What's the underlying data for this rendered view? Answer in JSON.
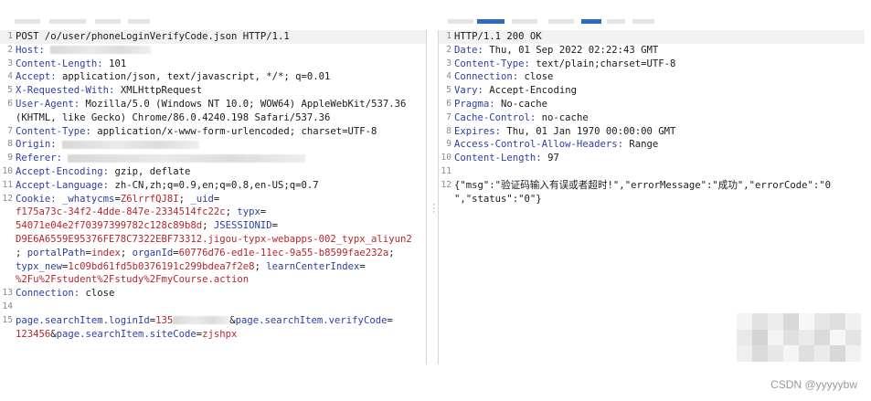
{
  "request": {
    "lines": [
      {
        "n": "1",
        "parts": [
          {
            "t": "POST /o/user/phoneLoginVerifyCode.json HTTP/1.1",
            "c": "hval"
          }
        ]
      },
      {
        "n": "2",
        "parts": [
          {
            "t": "Host: ",
            "c": "hname"
          }
        ],
        "redact": 110
      },
      {
        "n": "3",
        "parts": [
          {
            "t": "Content-Length: ",
            "c": "hname"
          },
          {
            "t": "101",
            "c": "hval"
          }
        ]
      },
      {
        "n": "4",
        "parts": [
          {
            "t": "Accept: ",
            "c": "hname"
          },
          {
            "t": "application/json, text/javascript, */*; q=0.01",
            "c": "hval"
          }
        ]
      },
      {
        "n": "5",
        "parts": [
          {
            "t": "X-Requested-With: ",
            "c": "hname"
          },
          {
            "t": "XMLHttpRequest",
            "c": "hval"
          }
        ]
      },
      {
        "n": "6",
        "parts": [
          {
            "t": "User-Agent: ",
            "c": "hname"
          },
          {
            "t": "Mozilla/5.0 (Windows NT 10.0; WOW64) AppleWebKit/537.36",
            "c": "hval"
          }
        ]
      },
      {
        "n": "",
        "parts": [
          {
            "t": "(KHTML, like Gecko) Chrome/86.0.4240.198 Safari/537.36",
            "c": "hval"
          }
        ]
      },
      {
        "n": "7",
        "parts": [
          {
            "t": "Content-Type: ",
            "c": "hname"
          },
          {
            "t": "application/x-www-form-urlencoded; charset=UTF-8",
            "c": "hval"
          }
        ]
      },
      {
        "n": "8",
        "parts": [
          {
            "t": "Origin: ",
            "c": "hname"
          }
        ],
        "redact": 150
      },
      {
        "n": "9",
        "parts": [
          {
            "t": "Referer: ",
            "c": "hname"
          }
        ],
        "redact": 260
      },
      {
        "n": "10",
        "parts": [
          {
            "t": "Accept-Encoding: ",
            "c": "hname"
          },
          {
            "t": "gzip, deflate",
            "c": "hval"
          }
        ]
      },
      {
        "n": "11",
        "parts": [
          {
            "t": "Accept-Language: ",
            "c": "hname"
          },
          {
            "t": "zh-CN,zh;q=0.9,en;q=0.8,en-US;q=0.7",
            "c": "hval"
          }
        ]
      },
      {
        "n": "12",
        "parts": [
          {
            "t": "Cookie: ",
            "c": "hname"
          },
          {
            "t": "_whatycms",
            "c": "blue"
          },
          {
            "t": "=",
            "c": "hval"
          },
          {
            "t": "Z6lrrfQJ8I",
            "c": "red"
          },
          {
            "t": "; ",
            "c": "hval"
          },
          {
            "t": "_uid",
            "c": "blue"
          },
          {
            "t": "=",
            "c": "hval"
          }
        ]
      },
      {
        "n": "",
        "parts": [
          {
            "t": "f175a73c-34f2-4dde-847e-2334514fc22c",
            "c": "red"
          },
          {
            "t": "; ",
            "c": "hval"
          },
          {
            "t": "typx",
            "c": "blue"
          },
          {
            "t": "=",
            "c": "hval"
          }
        ]
      },
      {
        "n": "",
        "parts": [
          {
            "t": "54071e04e2f70397399782c128c89b8d",
            "c": "red"
          },
          {
            "t": "; ",
            "c": "hval"
          },
          {
            "t": "JSESSIONID",
            "c": "blue"
          },
          {
            "t": "=",
            "c": "hval"
          }
        ]
      },
      {
        "n": "",
        "parts": [
          {
            "t": "D9E6A6559E95376FE78C7322EBF73312.jigou-typx-webapps-002_typx_aliyun2",
            "c": "red"
          }
        ]
      },
      {
        "n": "",
        "parts": [
          {
            "t": "; ",
            "c": "hval"
          },
          {
            "t": "portalPath",
            "c": "blue"
          },
          {
            "t": "=",
            "c": "hval"
          },
          {
            "t": "index",
            "c": "red"
          },
          {
            "t": "; ",
            "c": "hval"
          },
          {
            "t": "organId",
            "c": "blue"
          },
          {
            "t": "=",
            "c": "hval"
          },
          {
            "t": "60776d76-ed1e-11ec-9a55-b8599fae232a",
            "c": "red"
          },
          {
            "t": ";",
            "c": "hval"
          }
        ]
      },
      {
        "n": "",
        "parts": [
          {
            "t": "typx_new",
            "c": "blue"
          },
          {
            "t": "=",
            "c": "hval"
          },
          {
            "t": "1c09bd61fd5b0376191c299bdea7f2e8",
            "c": "red"
          },
          {
            "t": "; ",
            "c": "hval"
          },
          {
            "t": "learnCenterIndex",
            "c": "blue"
          },
          {
            "t": "=",
            "c": "hval"
          }
        ]
      },
      {
        "n": "",
        "parts": [
          {
            "t": "%2Fu%2Fstudent%2Fstudy%2FmyCourse.action",
            "c": "red"
          }
        ]
      },
      {
        "n": "13",
        "parts": [
          {
            "t": "Connection: ",
            "c": "hname"
          },
          {
            "t": "close",
            "c": "hval"
          }
        ]
      },
      {
        "n": "14",
        "parts": []
      },
      {
        "n": "15",
        "parts": [
          {
            "t": "page.searchItem.loginId",
            "c": "blue"
          },
          {
            "t": "=",
            "c": "hval"
          },
          {
            "t": "135",
            "c": "red"
          },
          {
            "t": "",
            "c": "hval"
          }
        ],
        "redact_inline": 62,
        "after": [
          {
            "t": "&",
            "c": "hval"
          },
          {
            "t": "page.searchItem.verifyCode",
            "c": "blue"
          },
          {
            "t": "=",
            "c": "hval"
          }
        ]
      },
      {
        "n": "",
        "parts": [
          {
            "t": "123456",
            "c": "red"
          },
          {
            "t": "&",
            "c": "hval"
          },
          {
            "t": "page.searchItem.siteCode",
            "c": "blue"
          },
          {
            "t": "=",
            "c": "hval"
          },
          {
            "t": "zjshpx",
            "c": "red"
          }
        ]
      }
    ]
  },
  "response": {
    "lines": [
      {
        "n": "1",
        "parts": [
          {
            "t": "HTTP/1.1 200 OK",
            "c": "hval"
          }
        ]
      },
      {
        "n": "2",
        "parts": [
          {
            "t": "Date: ",
            "c": "hname"
          },
          {
            "t": "Thu, 01 Sep 2022 02:22:43 GMT",
            "c": "hval"
          }
        ]
      },
      {
        "n": "3",
        "parts": [
          {
            "t": "Content-Type: ",
            "c": "hname"
          },
          {
            "t": "text/plain;charset=UTF-8",
            "c": "hval"
          }
        ]
      },
      {
        "n": "4",
        "parts": [
          {
            "t": "Connection: ",
            "c": "hname"
          },
          {
            "t": "close",
            "c": "hval"
          }
        ]
      },
      {
        "n": "5",
        "parts": [
          {
            "t": "Vary: ",
            "c": "hname"
          },
          {
            "t": "Accept-Encoding",
            "c": "hval"
          }
        ]
      },
      {
        "n": "6",
        "parts": [
          {
            "t": "Pragma: ",
            "c": "hname"
          },
          {
            "t": "No-cache",
            "c": "hval"
          }
        ]
      },
      {
        "n": "7",
        "parts": [
          {
            "t": "Cache-Control: ",
            "c": "hname"
          },
          {
            "t": "no-cache",
            "c": "hval"
          }
        ]
      },
      {
        "n": "8",
        "parts": [
          {
            "t": "Expires: ",
            "c": "hname"
          },
          {
            "t": "Thu, 01 Jan 1970 00:00:00 GMT",
            "c": "hval"
          }
        ]
      },
      {
        "n": "9",
        "parts": [
          {
            "t": "Access-Control-Allow-Headers: ",
            "c": "hname"
          },
          {
            "t": "Range",
            "c": "hval"
          }
        ]
      },
      {
        "n": "10",
        "parts": [
          {
            "t": "Content-Length: ",
            "c": "hname"
          },
          {
            "t": "97",
            "c": "hval"
          }
        ]
      },
      {
        "n": "11",
        "parts": []
      },
      {
        "n": "12",
        "parts": [
          {
            "t": "{\"msg\":\"验证码输入有误或者超时!\",\"errorMessage\":\"成功\",\"errorCode\":\"0",
            "c": "hval"
          }
        ]
      },
      {
        "n": "",
        "parts": [
          {
            "t": "\",\"status\":\"0\"}",
            "c": "hval"
          }
        ]
      }
    ]
  },
  "watermark": "CSDN @yyyyybw",
  "colors": {
    "accent_tab": "#2f6bbd",
    "header_name": "#2c3ea5",
    "cookie_value": "#b9242c"
  }
}
